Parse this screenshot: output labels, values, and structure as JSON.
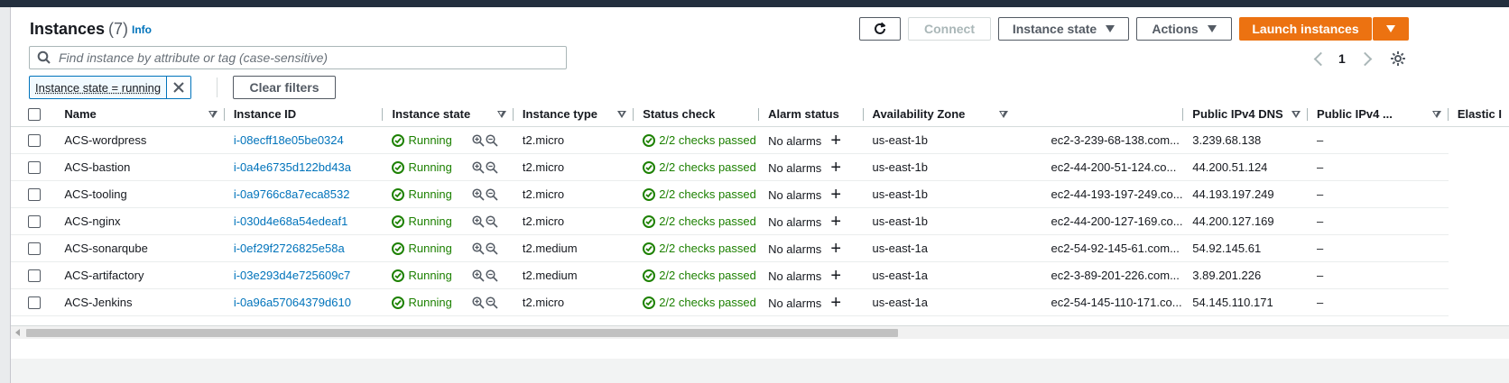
{
  "header": {
    "title": "Instances",
    "count": "(7)",
    "info_label": "Info"
  },
  "toolbar": {
    "refresh_icon": "refresh-icon",
    "connect_label": "Connect",
    "instance_state_label": "Instance state",
    "actions_label": "Actions",
    "launch_label": "Launch instances"
  },
  "search": {
    "placeholder": "Find instance by attribute or tag (case-sensitive)"
  },
  "pagination": {
    "current_page": "1"
  },
  "filter": {
    "token_label": "Instance state = running",
    "clear_label": "Clear filters"
  },
  "table": {
    "columns": [
      "Name",
      "Instance ID",
      "Instance state",
      "Instance type",
      "Status check",
      "Alarm status",
      "Availability Zone",
      "Public IPv4 DNS",
      "Public IPv4 ...",
      "Elastic I"
    ],
    "rows": [
      {
        "name": "ACS-wordpress",
        "id": "i-08ecff18e05be0324",
        "state": "Running",
        "type": "t2.micro",
        "status": "2/2 checks passed",
        "alarm": "No alarms",
        "az": "us-east-1b",
        "dns": "ec2-3-239-68-138.com...",
        "ip": "3.239.68.138",
        "eip": "–"
      },
      {
        "name": "ACS-bastion",
        "id": "i-0a4e6735d122bd43a",
        "state": "Running",
        "type": "t2.micro",
        "status": "2/2 checks passed",
        "alarm": "No alarms",
        "az": "us-east-1b",
        "dns": "ec2-44-200-51-124.co...",
        "ip": "44.200.51.124",
        "eip": "–"
      },
      {
        "name": "ACS-tooling",
        "id": "i-0a9766c8a7eca8532",
        "state": "Running",
        "type": "t2.micro",
        "status": "2/2 checks passed",
        "alarm": "No alarms",
        "az": "us-east-1b",
        "dns": "ec2-44-193-197-249.co...",
        "ip": "44.193.197.249",
        "eip": "–"
      },
      {
        "name": "ACS-nginx",
        "id": "i-030d4e68a54edeaf1",
        "state": "Running",
        "type": "t2.micro",
        "status": "2/2 checks passed",
        "alarm": "No alarms",
        "az": "us-east-1b",
        "dns": "ec2-44-200-127-169.co...",
        "ip": "44.200.127.169",
        "eip": "–"
      },
      {
        "name": "ACS-sonarqube",
        "id": "i-0ef29f2726825e58a",
        "state": "Running",
        "type": "t2.medium",
        "status": "2/2 checks passed",
        "alarm": "No alarms",
        "az": "us-east-1a",
        "dns": "ec2-54-92-145-61.com...",
        "ip": "54.92.145.61",
        "eip": "–"
      },
      {
        "name": "ACS-artifactory",
        "id": "i-03e293d4e725609c7",
        "state": "Running",
        "type": "t2.medium",
        "status": "2/2 checks passed",
        "alarm": "No alarms",
        "az": "us-east-1a",
        "dns": "ec2-3-89-201-226.com...",
        "ip": "3.89.201.226",
        "eip": "–"
      },
      {
        "name": "ACS-Jenkins",
        "id": "i-0a96a57064379d610",
        "state": "Running",
        "type": "t2.micro",
        "status": "2/2 checks passed",
        "alarm": "No alarms",
        "az": "us-east-1a",
        "dns": "ec2-54-145-110-171.co...",
        "ip": "54.145.110.171",
        "eip": "–"
      }
    ]
  },
  "colors": {
    "accent": "#0073bb",
    "primary": "#ec7211",
    "success": "#1d8102",
    "topbar": "#232f3e"
  }
}
